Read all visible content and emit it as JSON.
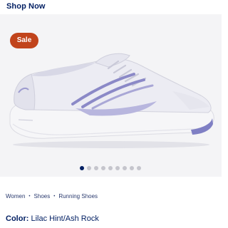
{
  "header": {
    "shop_now_label": "Shop Now"
  },
  "gallery": {
    "badge_label": "Sale",
    "image_count": 9,
    "active_index": 0,
    "colors": {
      "badge": "#c1441c",
      "dot_active": "#001e62",
      "dot_inactive": "#c5c5cc"
    }
  },
  "breadcrumb": {
    "items": [
      "Women",
      "Shoes",
      "Running Shoes"
    ],
    "separator": "•"
  },
  "product": {
    "color_label": "Color:",
    "color_value": "Lilac Hint/Ash Rock"
  }
}
